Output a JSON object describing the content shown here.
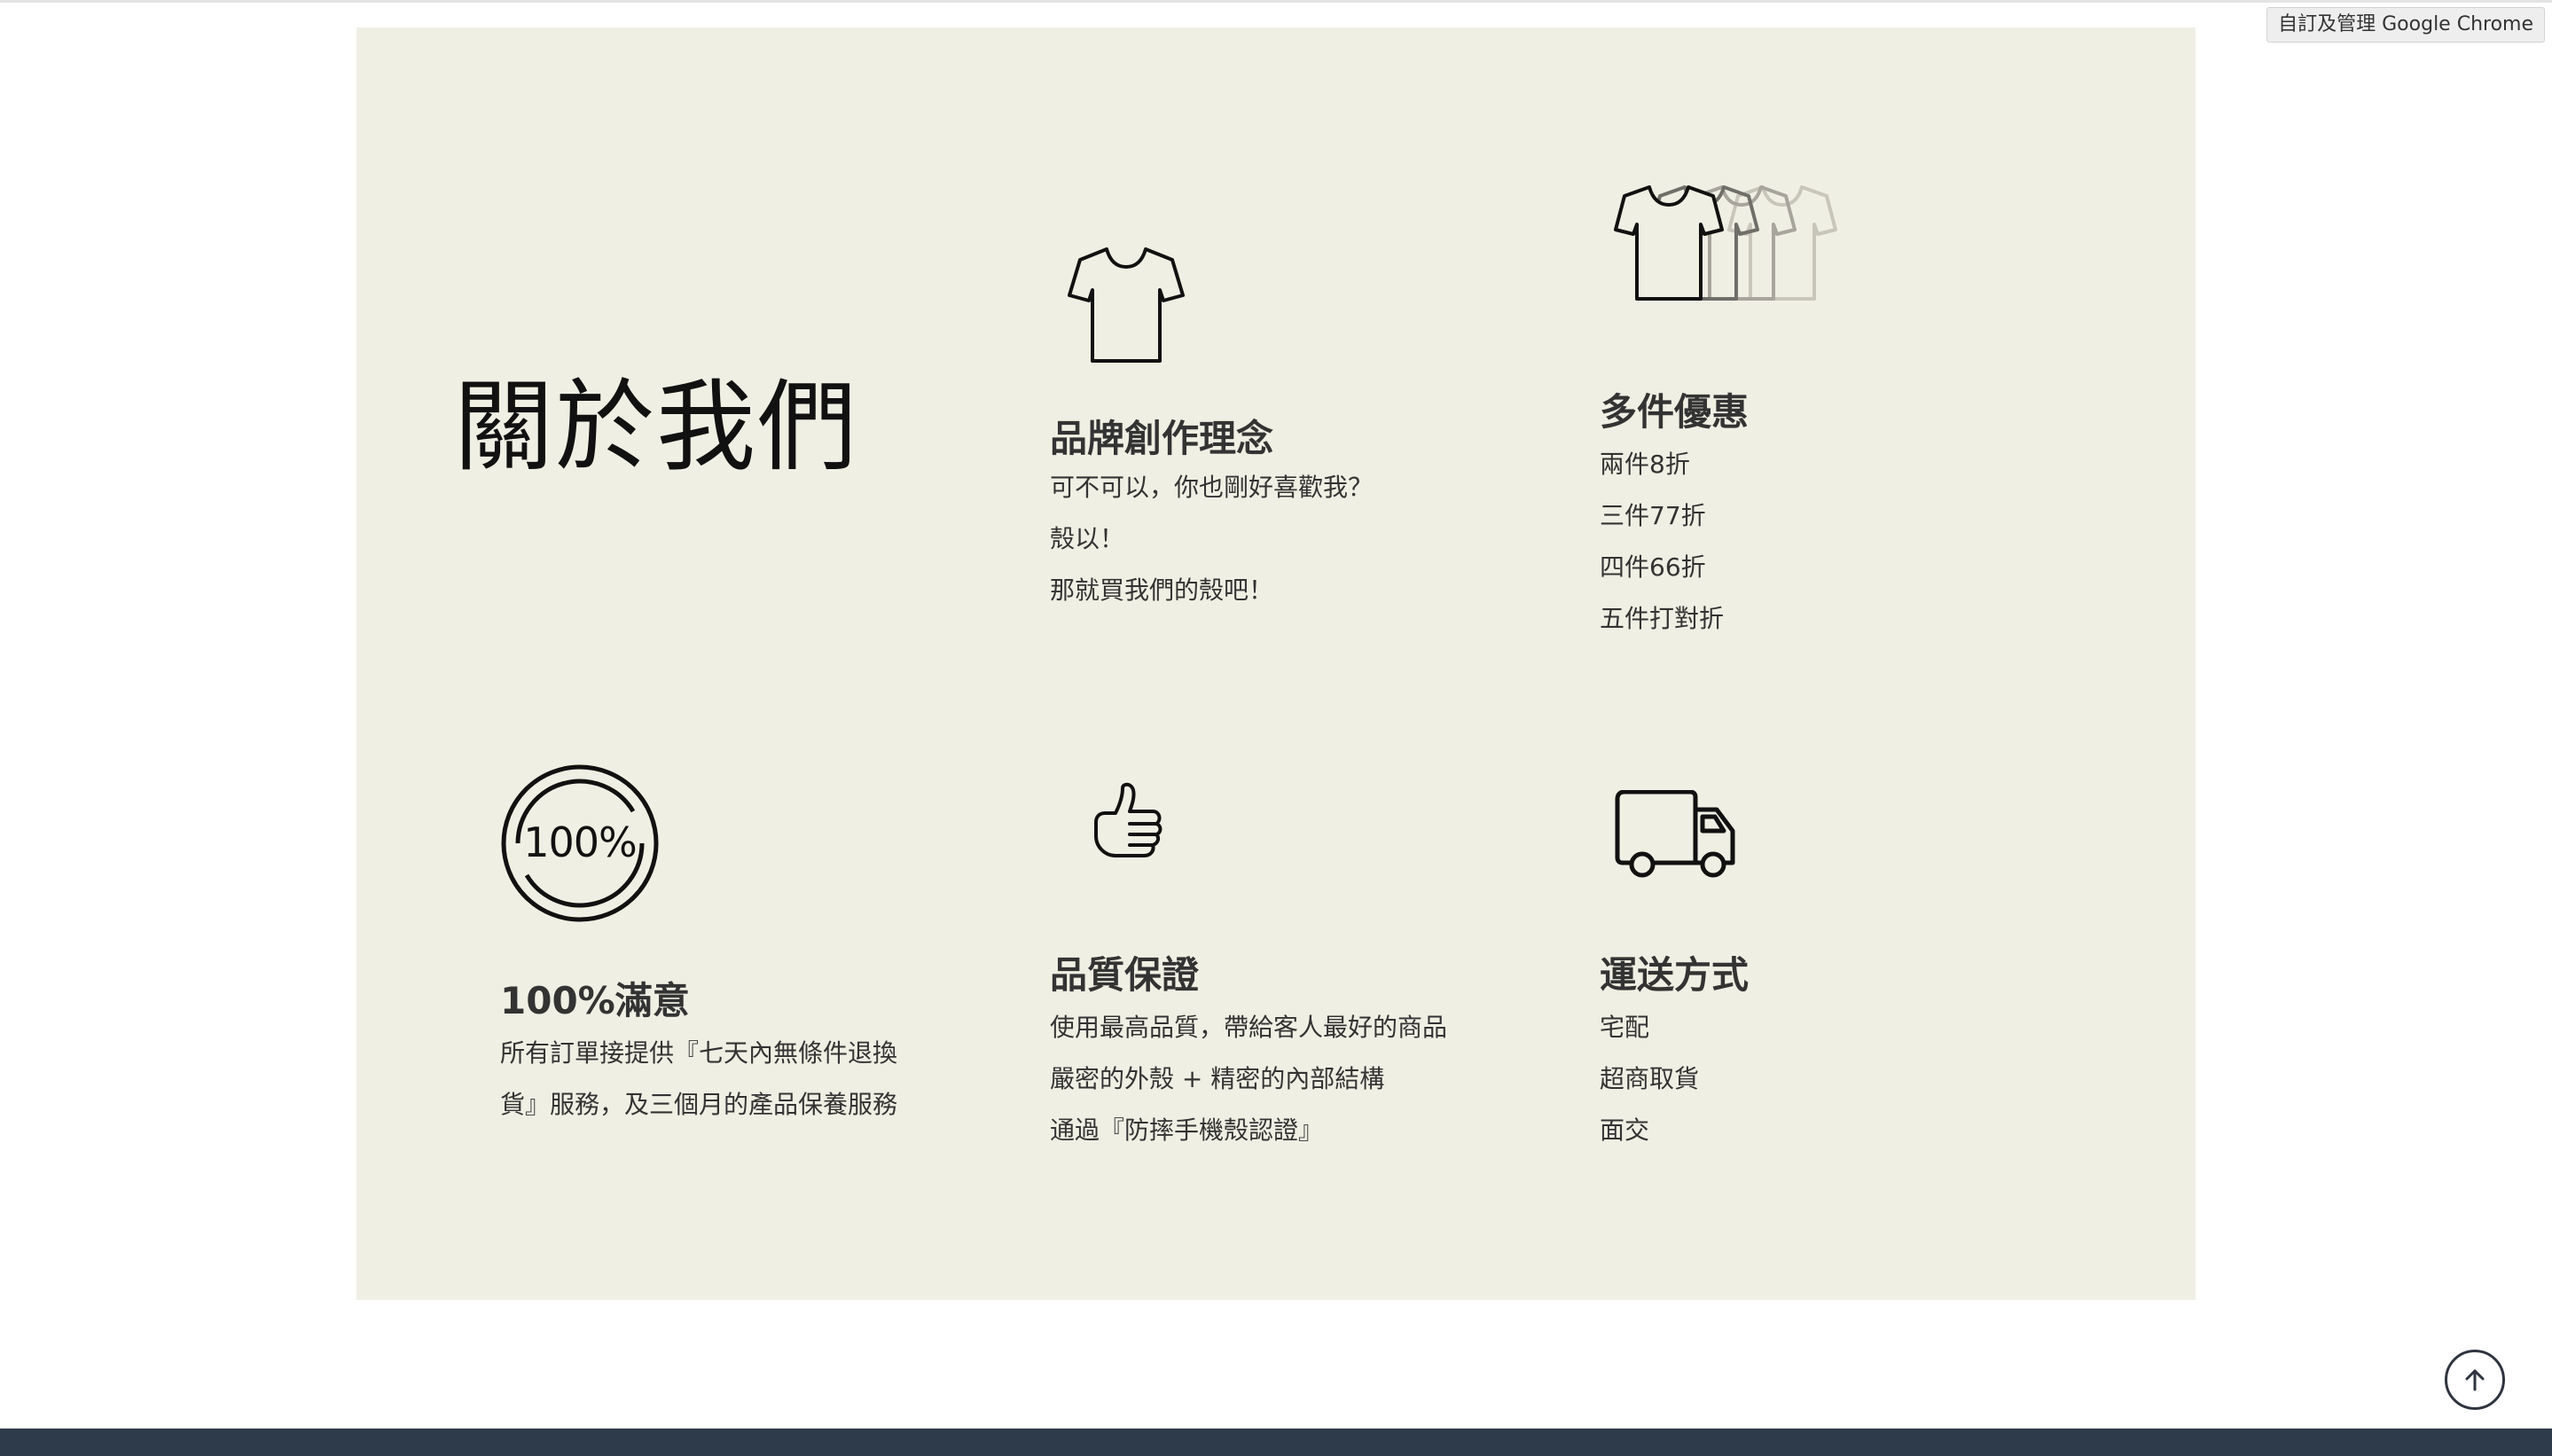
{
  "browser": {
    "tooltip": "自訂及管理 Google Chrome"
  },
  "about": {
    "title": "關於我們",
    "features": {
      "brand": {
        "title": "品牌創作理念",
        "lines": [
          "可不可以，你也剛好喜歡我？",
          "殼以！",
          "那就買我們的殼吧！"
        ],
        "icon": "tshirt-icon"
      },
      "multi": {
        "title": "多件優惠",
        "lines": [
          "兩件8折",
          "三件77折",
          "四件66折",
          "五件打對折"
        ],
        "icon": "tshirt-stack-icon"
      },
      "satisfy": {
        "title": "100%滿意",
        "lines": [
          "所有訂單接提供『七天內無條件退換",
          "貨』服務，及三個月的產品保養服務"
        ],
        "icon": "badge-100-icon",
        "badge_text": "100%"
      },
      "quality": {
        "title": "品質保證",
        "lines": [
          "使用最高品質，帶給客人最好的商品",
          "嚴密的外殼 + 精密的內部結構",
          "通過『防摔手機殼認證』"
        ],
        "icon": "thumbs-up-icon"
      },
      "ship": {
        "title": "運送方式",
        "lines": [
          "宅配",
          "超商取貨",
          "面交"
        ],
        "icon": "truck-icon"
      }
    }
  },
  "controls": {
    "back_to_top_icon": "arrow-up-icon"
  },
  "colors": {
    "panel_bg": "#f0efe4",
    "footer_bg": "#2e3b4a",
    "text": "#333333"
  }
}
